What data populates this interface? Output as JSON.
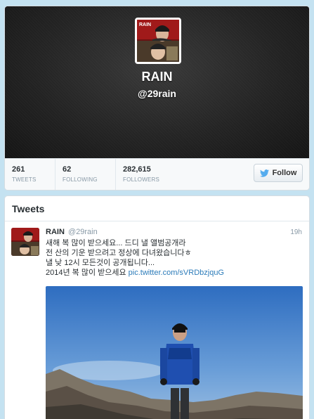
{
  "profile": {
    "name": "RAIN",
    "handle": "@29rain",
    "avatar_logo_text": "RAIN"
  },
  "stats": [
    {
      "value": "261",
      "label": "TWEETS"
    },
    {
      "value": "62",
      "label": "FOLLOWING"
    },
    {
      "value": "282,615",
      "label": "FOLLOWERS"
    }
  ],
  "follow_button": {
    "label": "Follow",
    "icon": "twitter-bird-icon"
  },
  "tweets_section": {
    "title": "Tweets"
  },
  "tweet": {
    "name": "RAIN",
    "handle": "@29rain",
    "time": "19h",
    "lines": [
      "새해 복 많이 받으세요... 드디 낼 앨범공개라",
      "전 산의 기운 받으려고 정상에 다녀왔습니다ㅎ",
      "낼 낮 12시 모든것이 공개됩니다...",
      "2014년 복 많이 받으세요"
    ],
    "link": "pic.twitter.com/sVRDbzjquG"
  },
  "colors": {
    "background": "#c4e2f1",
    "link": "#2b7bb9",
    "twitter_blue": "#55acee",
    "header_dark": "#222222"
  }
}
